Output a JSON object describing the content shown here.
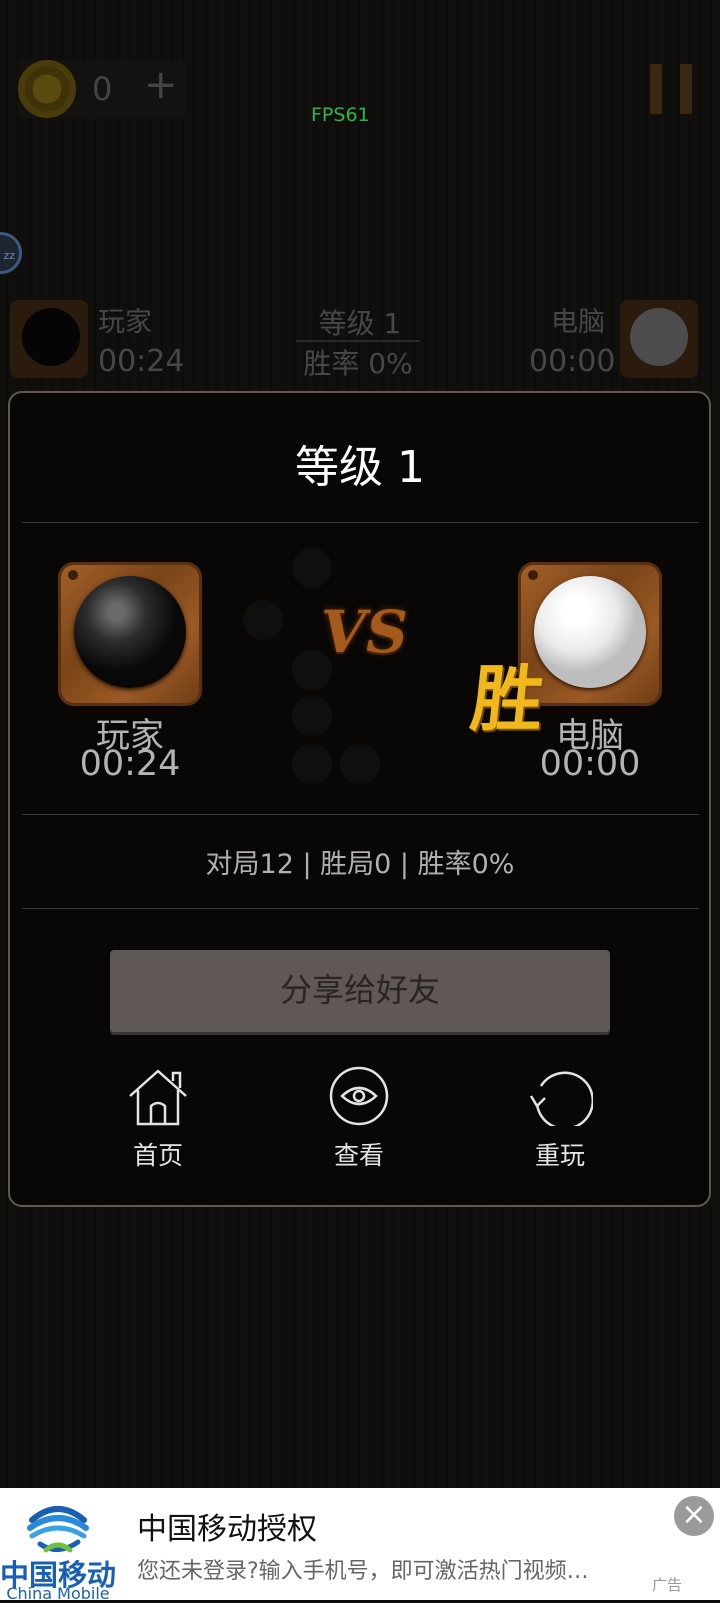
{
  "hud": {
    "coins": "0",
    "plus": "+",
    "fps": "FPS61",
    "bubble": "zz"
  },
  "top_bar": {
    "player_name": "玩家",
    "player_time": "00:24",
    "level": "等级 1",
    "win_rate": "胜率 0%",
    "cpu_name": "电脑",
    "cpu_time": "00:00"
  },
  "result_dialog": {
    "title": "等级 1",
    "player": {
      "name": "玩家",
      "time": "00:24",
      "stone": "black"
    },
    "cpu": {
      "name": "电脑",
      "time": "00:00",
      "stone": "white"
    },
    "vs": "VS",
    "winner_badge": "胜",
    "stats": "对局12 | 胜局0 | 胜率0%",
    "share_button": "分享给好友",
    "actions": [
      {
        "label": "首页",
        "icon": "home-icon"
      },
      {
        "label": "查看",
        "icon": "eye-icon"
      },
      {
        "label": "重玩",
        "icon": "replay-icon"
      }
    ]
  },
  "ad": {
    "brand_cn": "中国移动",
    "brand_en": "China Mobile",
    "title": "中国移动授权",
    "subtitle": "您还未登录?输入手机号，即可激活热门视频…",
    "close": "×",
    "badge": "广告"
  },
  "colors": {
    "fps": "#2fb34a",
    "win_badge": "#f0b81c",
    "share_button_bg": "#5f5854",
    "china_mobile_blue": "#1a5fb4"
  }
}
